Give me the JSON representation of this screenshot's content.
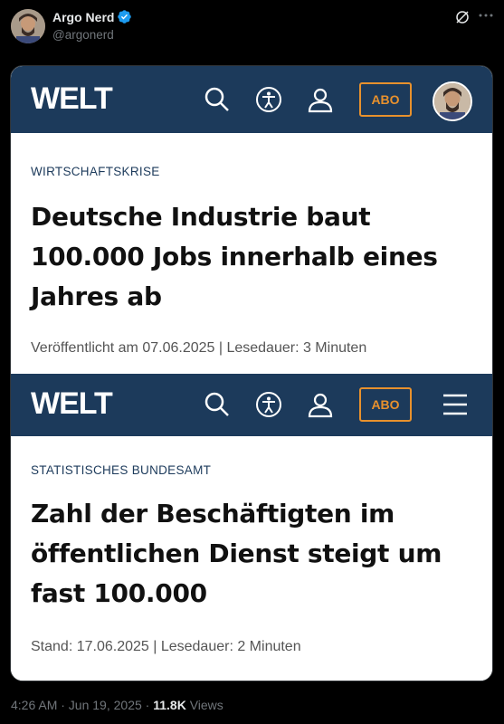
{
  "tweet": {
    "author_name": "Argo Nerd",
    "handle": "@argonerd",
    "timestamp": "4:26 AM · Jun 19, 2025 · ",
    "views_count": "11.8K",
    "views_label": " Views"
  },
  "screens": [
    {
      "logo": "WELT",
      "abo_label": "ABO",
      "kicker": "WIRTSCHAFTSKRISE",
      "headline": "Deutsche Industrie baut 100.000 Jobs innerhalb eines Jahres ab",
      "meta": "Veröffentlicht am 07.06.2025 | Lesedauer: 3 Minuten"
    },
    {
      "logo": "WELT",
      "abo_label": "ABO",
      "kicker": "STATISTISCHES BUNDESAMT",
      "headline": "Zahl der Beschäftigten im öffentlichen Dienst steigt um fast 100.000",
      "meta": "Stand: 17.06.2025 | Lesedauer: 2 Minuten"
    }
  ],
  "colors": {
    "welt_navy": "#1c3a5b",
    "abo_orange": "#e8912d",
    "verified_blue": "#1d9bf0"
  }
}
